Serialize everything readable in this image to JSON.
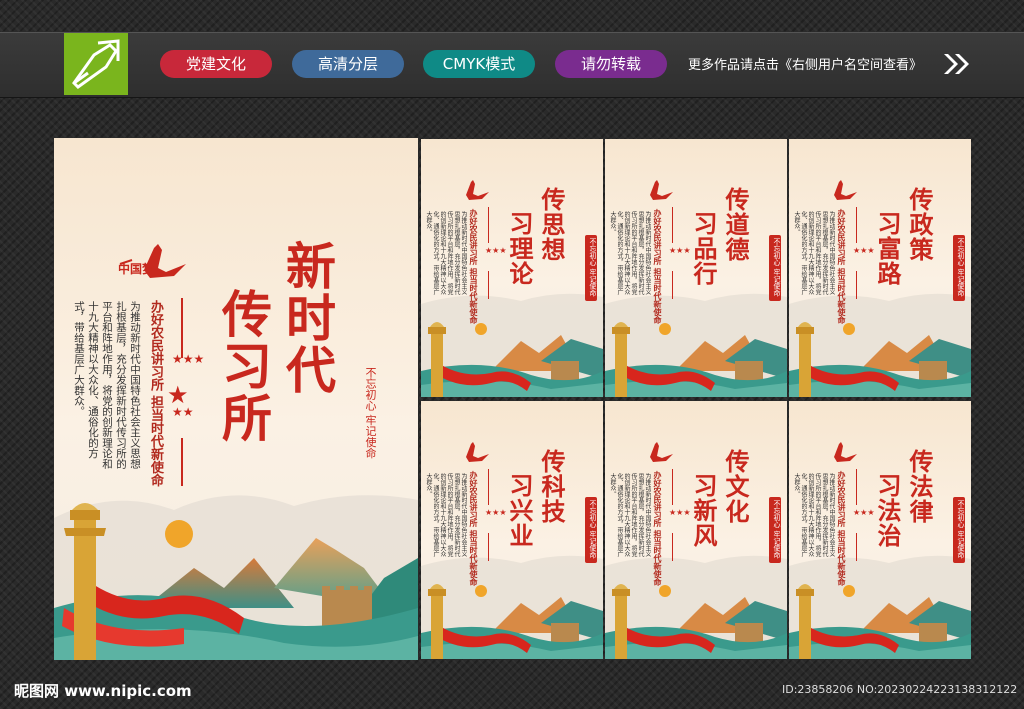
{
  "header": {
    "pills": [
      {
        "label": "党建文化",
        "color": "#c8283a"
      },
      {
        "label": "高清分层",
        "color": "#3f6a9a"
      },
      {
        "label": "CMYK模式",
        "color": "#0f8a86"
      },
      {
        "label": "请勿转载",
        "color": "#7a2c8f"
      }
    ],
    "tagline": "更多作品请点击《右侧用户名空间查看》"
  },
  "main_poster": {
    "logo_text": "中国梦",
    "title_line1": "新时代",
    "title_line2": "传习所",
    "subtitle": "办好农民讲习所  担当时代新使命",
    "body": "为推动新时代中国特色社会主义思想扎根基层，充分发挥新时代传习所的平台和阵地作用，将党的创新理论和十九大精神以大众化、通俗化的方式，带给基层广大群众。",
    "seal_text": "不忘初心  牢记使命"
  },
  "small_posters": [
    {
      "title_a": "传思想",
      "title_b": "习理论"
    },
    {
      "title_a": "传道德",
      "title_b": "习品行"
    },
    {
      "title_a": "传政策",
      "title_b": "习富路"
    },
    {
      "title_a": "传科技",
      "title_b": "习兴业"
    },
    {
      "title_a": "传文化",
      "title_b": "习新风"
    },
    {
      "title_a": "传法律",
      "title_b": "习法治"
    }
  ],
  "small_common": {
    "subtitle": "办好农民讲习所  担当时代新使命",
    "body": "为推动新时代中国特色社会主义思想扎根基层，充分发挥新时代传习所的平台和阵地作用，将党的创新理论和十九大精神以大众化、通俗化的方式，带给基层广大群众。",
    "seal_text": "不忘初心  牢记使命",
    "logo_text": "中国梦"
  },
  "footer": {
    "site": "昵图网 www.nipic.com",
    "id": "ID:23858206 NO:20230224223138312122"
  }
}
